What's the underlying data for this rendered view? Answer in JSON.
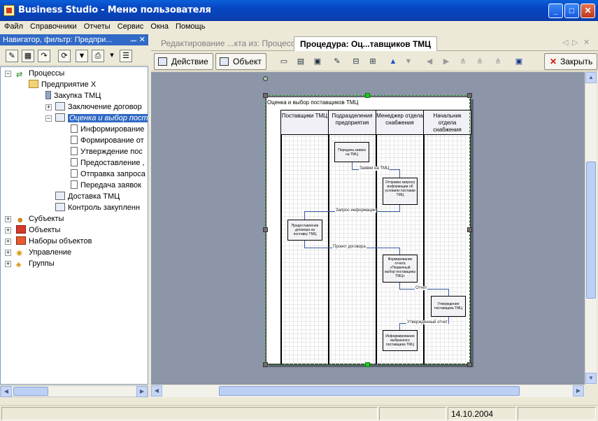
{
  "window": {
    "title": "Business Studio - Меню пользователя"
  },
  "menu": [
    "Файл",
    "Справочники",
    "Отчеты",
    "Сервис",
    "Окна",
    "Помощь"
  ],
  "navigator": {
    "header": "Навигатор, фильтр: Предпри...",
    "pin": "₽",
    "close": "✕"
  },
  "tree": [
    {
      "label": "Процессы"
    },
    {
      "label": "Предприятие Х"
    },
    {
      "label": "Закупка ТМЦ"
    },
    {
      "label": "Заключение договор"
    },
    {
      "label": "Оценка и выбор пост"
    },
    {
      "label": "Информирование"
    },
    {
      "label": "Формирование от"
    },
    {
      "label": "Утверждение пос"
    },
    {
      "label": "Предоставление ,"
    },
    {
      "label": "Отправка запроса"
    },
    {
      "label": "Передача заявок"
    },
    {
      "label": "Доставка ТМЦ"
    },
    {
      "label": "Контроль закупленн"
    },
    {
      "label": "Субъекты"
    },
    {
      "label": "Объекты"
    },
    {
      "label": "Наборы объектов"
    },
    {
      "label": "Управление"
    },
    {
      "label": "Группы"
    }
  ],
  "tabs": {
    "inactive": "Редактирование ...кта из: Процессы",
    "active": "Процедура: Оц...тавщиков ТМЦ"
  },
  "toolbar": {
    "action": "Действие",
    "object": "Объект",
    "close": "Закрыть"
  },
  "diagram": {
    "title": "Оценка и выбор поставщиков ТМЦ",
    "lanes": [
      "Поставщики ТМЦ",
      "Подразделения предприятия",
      "Менеджер отдела снабжения",
      "Начальник отдела снабжения"
    ],
    "boxes": [
      "Передача заявок на ТМЦ",
      "Отправка запроса информации об условиях поставки ТМЦ",
      "Предоставление договора на поставку ТМЦ",
      "Формирование отчета «Первичный выбор поставщика ТМЦ»",
      "Утверждение поставщика ТМЦ",
      "Информирование выбранного поставщика ТМЦ"
    ],
    "labels": [
      "Заявки на ТМЦ",
      "Запрос информации",
      "Проект договора",
      "Отчет",
      "Утвержденный отчет"
    ]
  },
  "status": {
    "date": "14.10.2004"
  }
}
